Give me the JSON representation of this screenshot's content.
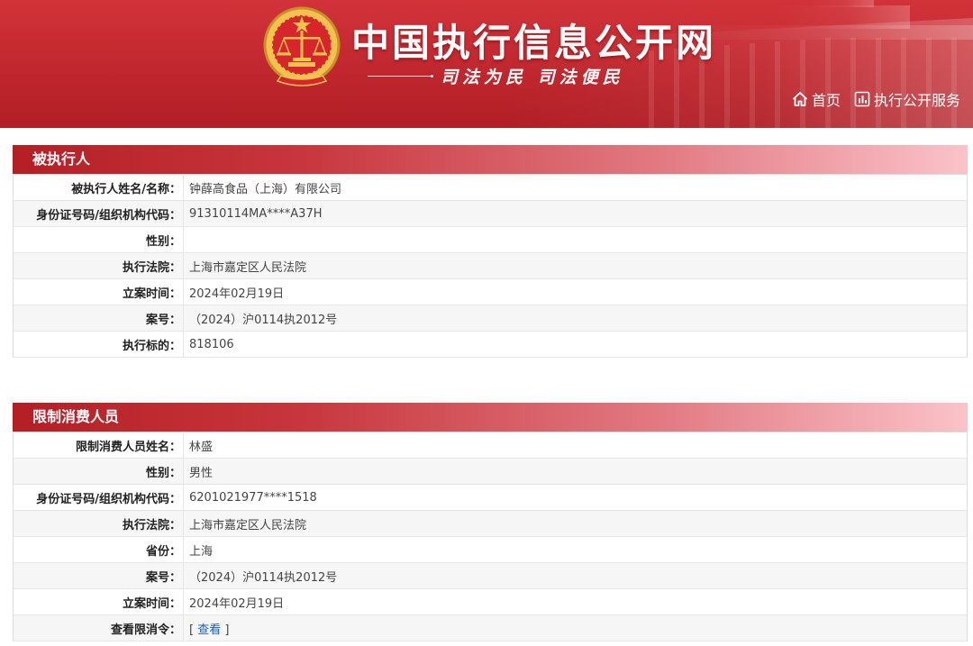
{
  "header": {
    "title": "中国执行信息公开网",
    "slogan": "司法为民  司法便民",
    "nav": {
      "home": "首页",
      "service": "执行公开服务"
    }
  },
  "debtor": {
    "heading": "被执行人",
    "rows": [
      {
        "label": "被执行人姓名/名称：",
        "value": "钟薛高食品（上海）有限公司"
      },
      {
        "label": "身份证号码/组织机构代码：",
        "value": "91310114MA****A37H"
      },
      {
        "label": "性别：",
        "value": ""
      },
      {
        "label": "执行法院：",
        "value": "上海市嘉定区人民法院"
      },
      {
        "label": "立案时间：",
        "value": "2024年02月19日"
      },
      {
        "label": "案号：",
        "value": "（2024）沪0114执2012号"
      },
      {
        "label": "执行标的：",
        "value": "818106"
      }
    ]
  },
  "restricted": {
    "heading": "限制消费人员",
    "rows": [
      {
        "label": "限制消费人员姓名：",
        "value": "林盛"
      },
      {
        "label": "性别：",
        "value": "男性"
      },
      {
        "label": "身份证号码/组织机构代码：",
        "value": "6201021977****1518"
      },
      {
        "label": "执行法院：",
        "value": "上海市嘉定区人民法院"
      },
      {
        "label": "省份：",
        "value": "上海"
      },
      {
        "label": "案号：",
        "value": "（2024）沪0114执2012号"
      },
      {
        "label": "立案时间：",
        "value": "2024年02月19日"
      },
      {
        "label": "查看限消令：",
        "link_open": "[ ",
        "link_text": "查看",
        "link_close": " ]"
      }
    ]
  },
  "icons": {
    "nav_home": "home-icon",
    "nav_service": "chart-icon",
    "logo": "court-emblem-icon"
  },
  "colors": {
    "banner_red": "#c0272e",
    "section_header_start": "#b41f25",
    "section_header_end": "#fac3c9",
    "link_blue": "#1a5fb4"
  }
}
